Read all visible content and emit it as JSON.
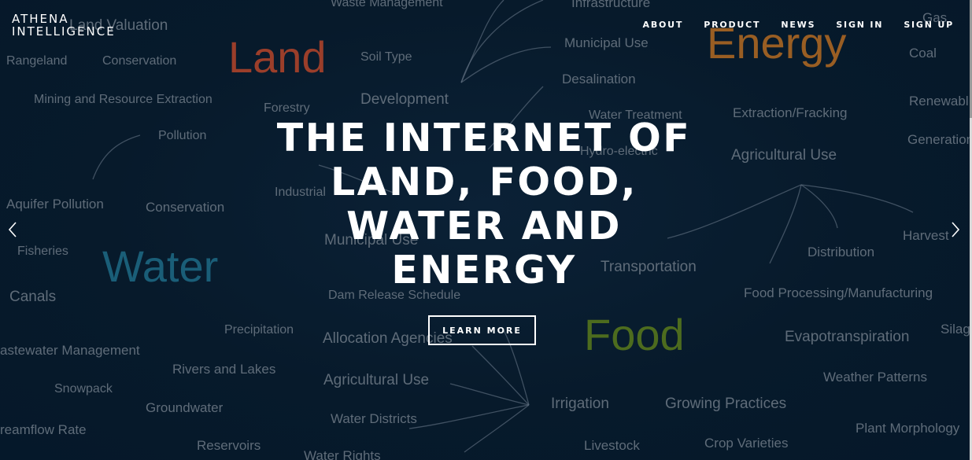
{
  "brand": {
    "line1": "ATHENA",
    "line2": "INTELLIGENCE"
  },
  "nav": {
    "about": "ABOUT",
    "product": "PRODUCT",
    "news": "NEWS",
    "sign_in": "SIGN IN",
    "sign_up": "SIGN UP"
  },
  "hero": {
    "line1": "THE INTERNET OF",
    "line2": "LAND, FOOD,",
    "line3": "WATER AND",
    "line4": "ENERGY",
    "cta": "LEARN MORE"
  },
  "carousel": {
    "prev_icon": "chevron-left-icon",
    "next_icon": "chevron-right-icon"
  },
  "word_cloud": {
    "topics": {
      "land": "Land",
      "energy": "Energy",
      "water": "Water",
      "food": "Food"
    },
    "terms": {
      "t1": "Land Valuation",
      "t2": "Waste Management",
      "t3": "Infrastructure",
      "t4": "Gas",
      "t5": "Rangeland",
      "t6": "Conservation",
      "t7": "Soil Type",
      "t8": "Municipal Use",
      "t9": "Coal",
      "t10": "Desalination",
      "t11": "Mining and Resource Extraction",
      "t12": "Development",
      "t13": "Renewabl",
      "t14": "Forestry",
      "t15": "Water Treatment",
      "t16": "Extraction/Fracking",
      "t17": "Pollution",
      "t18": "Generation",
      "t19": "Hydro-electric",
      "t20": "Agricultural Use",
      "t21": "Industrial",
      "t22": "Aquifer Pollution",
      "t23": "Conservation",
      "t24": "Harvest",
      "t25": "Municipal Use",
      "t26": "Fisheries",
      "t27": "Distribution",
      "t28": "Transportation",
      "t29": "Canals",
      "t30": "Dam Release Schedule",
      "t31": "Food Processing/Manufacturing",
      "t32": "Precipitation",
      "t33": "Allocation Agencies",
      "t34": "Silag",
      "t35": "astewater Management",
      "t36": "Evapotranspiration",
      "t37": "Rivers and Lakes",
      "t38": "Weather Patterns",
      "t39": "Agricultural Use",
      "t40": "Snowpack",
      "t41": "Irrigation",
      "t42": "Growing Practices",
      "t43": "Groundwater",
      "t44": "Water Districts",
      "t45": "Plant Morphology",
      "t46": "reamflow Rate",
      "t47": "Reservoirs",
      "t48": "Livestock",
      "t49": "Crop Varieties",
      "t50": "Water Rights"
    }
  }
}
